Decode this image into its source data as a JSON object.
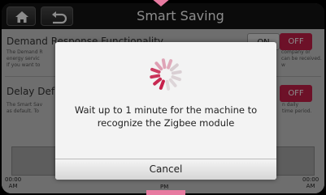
{
  "header": {
    "title": "Smart Saving",
    "home_icon": "home-icon",
    "back_icon": "back-arrow-icon"
  },
  "background": {
    "demand_title": "Demand Response Functionality",
    "demand_desc_lines": [
      "The Demand R",
      "energy servic",
      "If you want to"
    ],
    "demand_desc_right": [
      "company or",
      "can be received.",
      "w"
    ],
    "toggle_on": "ON",
    "toggle_off": "OFF",
    "delay_title": "Delay Def",
    "delay_desc_lines": [
      "The Smart Sav",
      "as default. To"
    ],
    "delay_desc_right": [
      "n daily",
      "time period."
    ],
    "delay_toggle_off": "OFF",
    "timeline": {
      "left_time": "00:00",
      "left_ampm": "AM",
      "mid_ampm": "PM",
      "right_time": "00:00",
      "right_ampm": "AM"
    }
  },
  "dialog": {
    "message": "Wait up to 1 minute for the machine to recognize the Zigbee module",
    "cancel_label": "Cancel",
    "spinner_icon": "loading-spinner-icon"
  },
  "colors": {
    "accent": "#c61f4a",
    "pointer": "#e77aa0"
  }
}
